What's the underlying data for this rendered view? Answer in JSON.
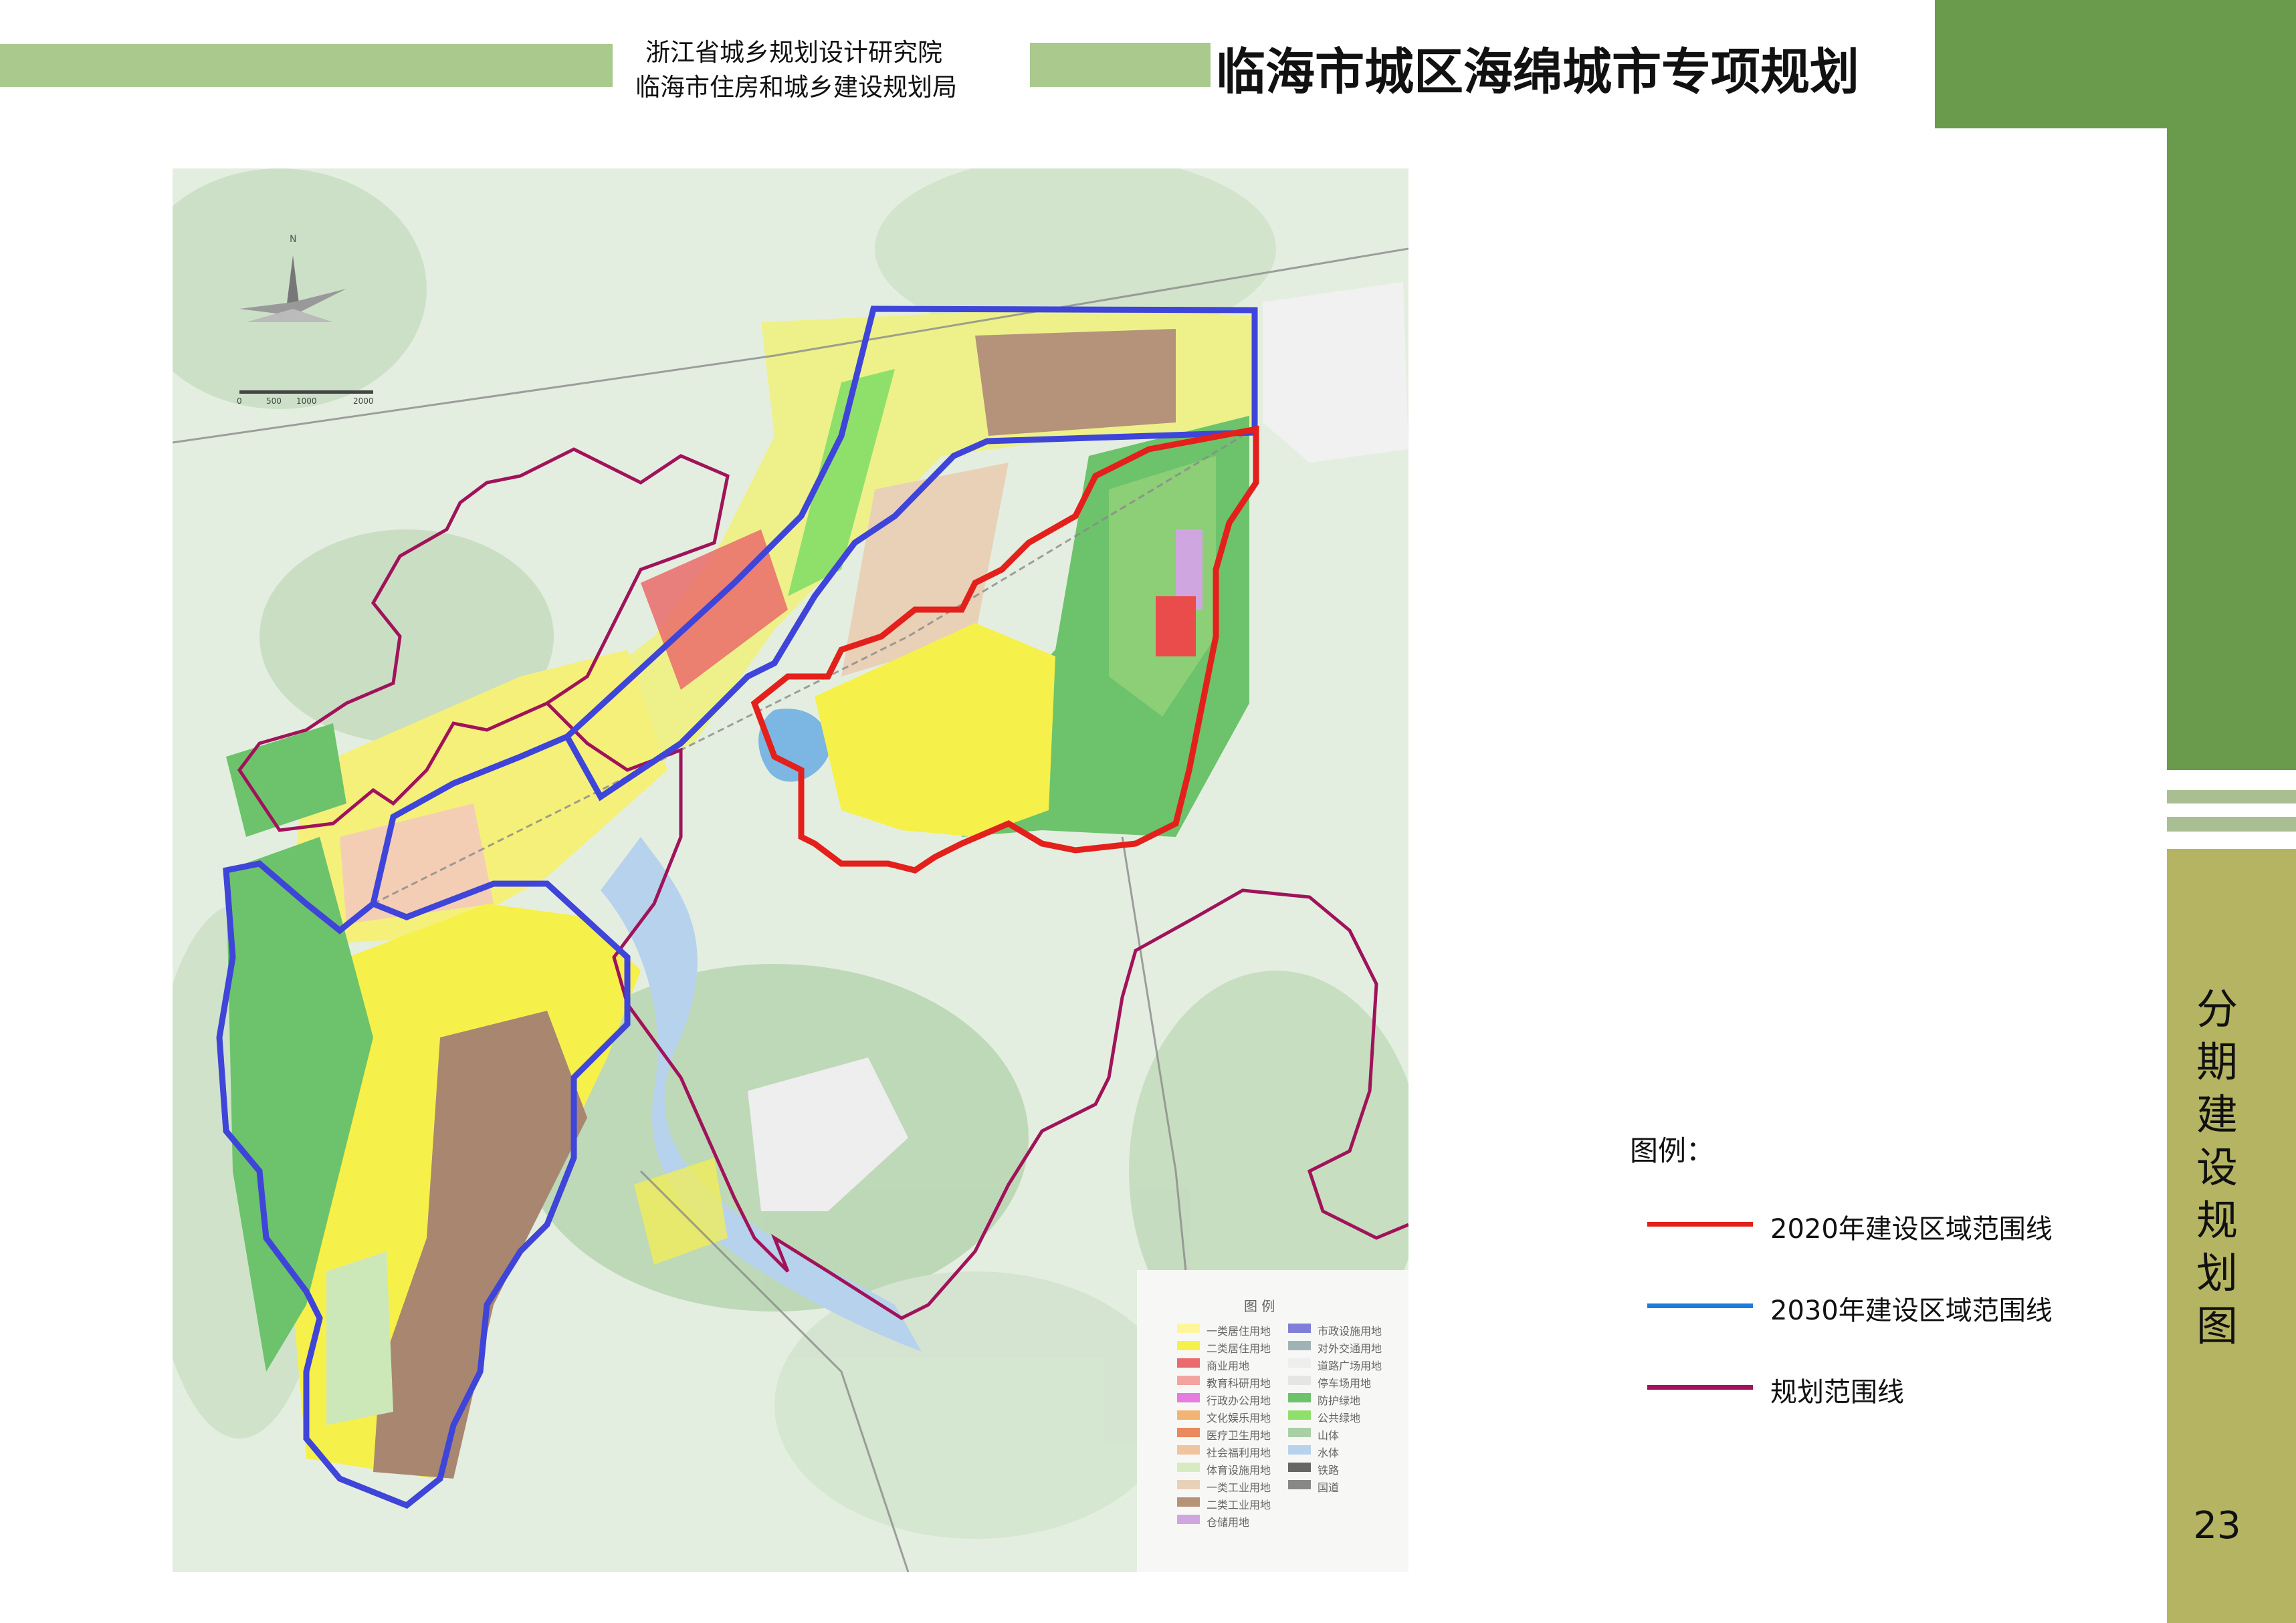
{
  "header": {
    "org_line1": "浙江省城乡规划设计研究院",
    "org_line2": "临海市住房和城乡建设规划局",
    "title": "临海市城区海绵城市专项规划"
  },
  "sidebar": {
    "title_chars": [
      "分",
      "期",
      "建",
      "设",
      "规",
      "划",
      "图"
    ],
    "page_number": "23"
  },
  "legend_main": {
    "title": "图例：",
    "items": [
      {
        "label": "2020年建设区域范围线",
        "color": "#e3201b"
      },
      {
        "label": "2030年建设区域范围线",
        "color": "#1f7be0"
      },
      {
        "label": "规划范围线",
        "color": "#a0135a"
      }
    ]
  },
  "map": {
    "north_label": "N",
    "scale_labels": [
      "0",
      "500",
      "1000",
      "2000"
    ],
    "inset_legend": {
      "title": "图  例",
      "col1": [
        {
          "label": "一类居住用地",
          "color": "#fff59a"
        },
        {
          "label": "二类居住用地",
          "color": "#f6f04a"
        },
        {
          "label": "商业用地",
          "color": "#ea6b6b"
        },
        {
          "label": "教育科研用地",
          "color": "#f3a3a0"
        },
        {
          "label": "行政办公用地",
          "color": "#e67be0"
        },
        {
          "label": "文化娱乐用地",
          "color": "#f2b472"
        },
        {
          "label": "医疗卫生用地",
          "color": "#e9895e"
        },
        {
          "label": "社会福利用地",
          "color": "#f0c49f"
        },
        {
          "label": "体育设施用地",
          "color": "#d8eac2"
        },
        {
          "label": "一类工业用地",
          "color": "#e9d1b8"
        },
        {
          "label": "二类工业用地",
          "color": "#b5927a"
        },
        {
          "label": "仓储用地",
          "color": "#cfa6e0"
        }
      ],
      "col2": [
        {
          "label": "市政设施用地",
          "color": "#7f7ed9"
        },
        {
          "label": "对外交通用地",
          "color": "#9fb3b7"
        },
        {
          "label": "道路广场用地",
          "color": "#eeeeee"
        },
        {
          "label": "停车场用地",
          "color": "#e5e5e5"
        },
        {
          "label": "防护绿地",
          "color": "#6cc36b"
        },
        {
          "label": "公共绿地",
          "color": "#8fe06a"
        },
        {
          "label": "山体",
          "color": "#a9cfa4"
        },
        {
          "label": "水体",
          "color": "#b7d2ec"
        },
        {
          "label": "铁路",
          "color": "#666666"
        },
        {
          "label": "国道",
          "color": "#888888"
        }
      ]
    }
  }
}
